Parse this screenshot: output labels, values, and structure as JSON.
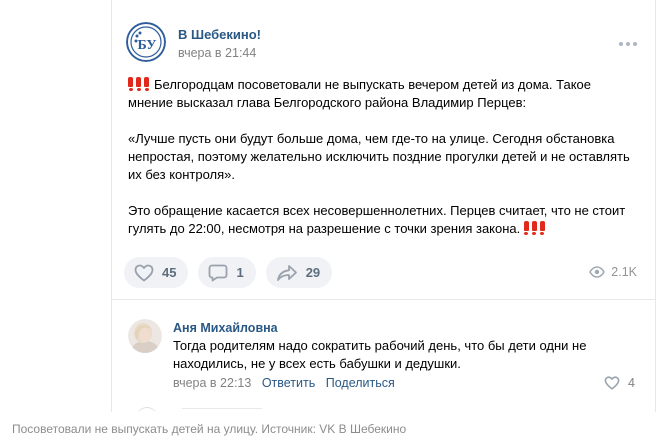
{
  "post": {
    "author": "В Шебекино!",
    "time": "вчера в 21:44",
    "logo_text": "БУ",
    "paragraphs": [
      "Белгородцам посоветовали не выпускать вечером детей из дома. Такое мнение высказал глава Белгородского района Владимир Перцев:",
      "«Лучше пусть они будут больше дома, чем где-то на улице. Сегодня обстановка непростая, поэтому желательно исключить поздние прогулки детей и не оставлять их без контроля».",
      "Это обращение касается всех несовершеннолетних. Перцев считает, что не стоит гулять до 22:00, несмотря на разрешение с точки зрения закона."
    ],
    "likes": "45",
    "comments": "1",
    "reposts": "29",
    "views": "2.1K"
  },
  "comment": {
    "author": "Аня Михайловна",
    "text": "Тогда родителям надо сократить рабочий день, что бы дети одни не находились, не у всех есть бабушки и дедушки.",
    "time": "вчера в 22:13",
    "reply_label": "Ответить",
    "share_label": "Поделиться",
    "likes": "4"
  },
  "caption": "Посоветовали не выпускать детей на улицу. Источник: VK В Шебекино",
  "colors": {
    "link": "#2a5885",
    "muted": "#828282",
    "pill_bg": "#f0f2f5",
    "exclamation": "#e0281b"
  },
  "icons": [
    "more-icon",
    "heart-icon",
    "comment-icon",
    "share-icon",
    "eye-icon",
    "exclamation-icon"
  ]
}
